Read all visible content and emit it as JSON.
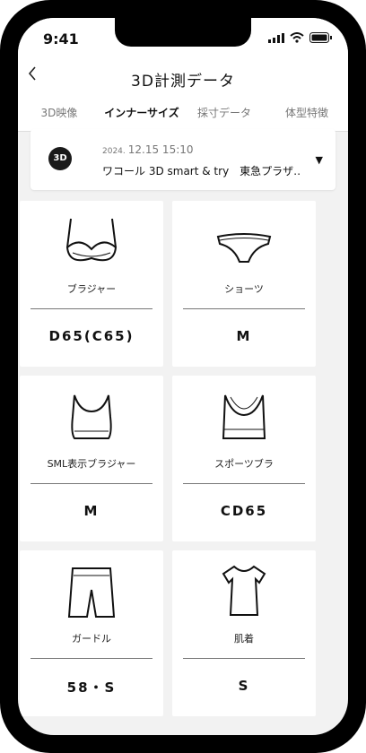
{
  "status": {
    "time": "9:41"
  },
  "header": {
    "back_icon": "chevron-left-icon",
    "title": "3D計測データ"
  },
  "tabs": [
    {
      "label": "3D映像",
      "active": false
    },
    {
      "label": "インナーサイズ",
      "active": true
    },
    {
      "label": "採寸データ",
      "active": false
    },
    {
      "label": "体型特徴",
      "active": false
    }
  ],
  "store": {
    "badge": "3D",
    "date_year": "2024.",
    "date": "12.15 15:10",
    "name": "ワコール 3D smart & try　東急プラザ…"
  },
  "items": [
    {
      "label": "ブラジャー",
      "size": "D65(C65)",
      "icon": "bra-icon"
    },
    {
      "label": "ショーツ",
      "size": "M",
      "icon": "shorts-icon"
    },
    {
      "label": "SML表示ブラジャー",
      "size": "M",
      "icon": "bralette-icon"
    },
    {
      "label": "スポーツブラ",
      "size": "CD65",
      "icon": "sports-bra-icon"
    },
    {
      "label": "ガードル",
      "size": "58・S",
      "icon": "girdle-icon"
    },
    {
      "label": "肌着",
      "size": "S",
      "icon": "undershirt-icon"
    }
  ]
}
